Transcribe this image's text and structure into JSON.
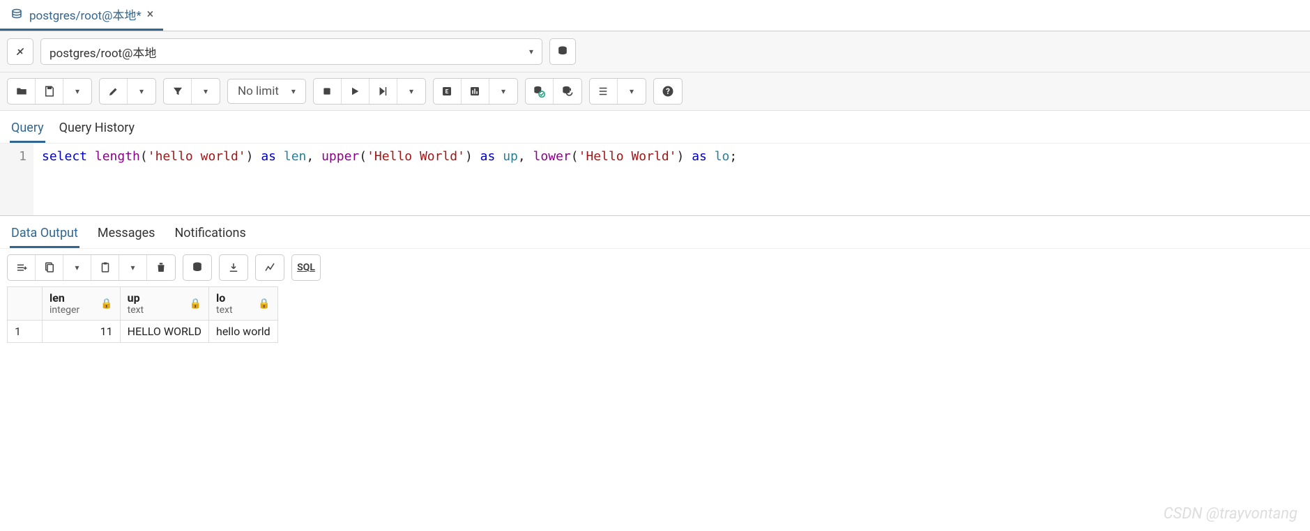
{
  "tab": {
    "title": "postgres/root@本地*"
  },
  "connection": {
    "label": "postgres/root@本地"
  },
  "toolbar": {
    "limit_label": "No limit",
    "sql_label": "SQL"
  },
  "editor_tabs": {
    "query": "Query",
    "history": "Query History"
  },
  "code": {
    "line_no": "1",
    "tokens": {
      "select": "select",
      "length": "length",
      "s1": "'hello world'",
      "as1": "as",
      "len": "len",
      "upper": "upper",
      "s2": "'Hello World'",
      "as2": "as",
      "up": "up",
      "lower": "lower",
      "s3": "'Hello World'",
      "as3": "as",
      "lo": "lo"
    }
  },
  "output_tabs": {
    "data": "Data Output",
    "messages": "Messages",
    "notifications": "Notifications"
  },
  "grid": {
    "columns": [
      {
        "name": "len",
        "type": "integer"
      },
      {
        "name": "up",
        "type": "text"
      },
      {
        "name": "lo",
        "type": "text"
      }
    ],
    "row_label": "1",
    "row": {
      "len": "11",
      "up": "HELLO WORLD",
      "lo": "hello world"
    }
  },
  "watermark": "CSDN @trayvontang"
}
